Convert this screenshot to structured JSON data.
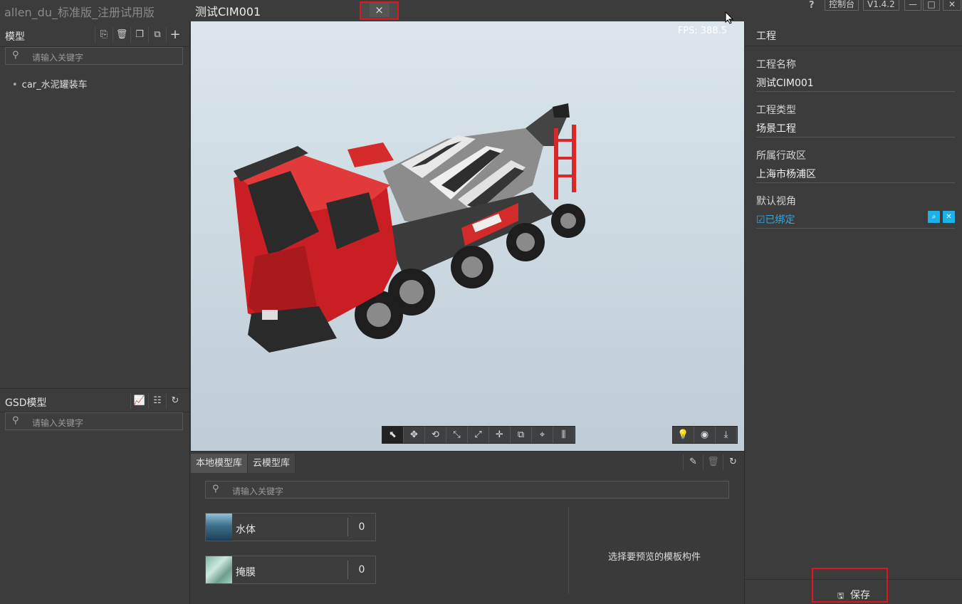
{
  "titlebar": {
    "app_title": "allen_du_标准版_注册试用版",
    "tab_title": "测试CIM001",
    "tab_close": "×",
    "help": "?",
    "console": "控制台",
    "version": "V1.4.2",
    "minimize": "—",
    "maximize": "□",
    "close": "✕"
  },
  "models_panel": {
    "title": "模型",
    "icons": [
      "export-icon",
      "trash-icon",
      "copy-icon",
      "paste-icon",
      "plus-icon"
    ],
    "search_placeholder": "请输入关键字",
    "items": [
      {
        "label": "car_水泥罐装车"
      }
    ]
  },
  "gsd_panel": {
    "title": "GSD模型",
    "icons": [
      "chart-icon",
      "layers-icon",
      "refresh-icon"
    ],
    "search_placeholder": "请输入关键字"
  },
  "viewport": {
    "fps": "FPS: 388.5",
    "tools": [
      "select-icon",
      "pan-icon",
      "orbit-icon",
      "shrink-icon",
      "expand-icon",
      "move-icon",
      "copy-tool-icon",
      "center-icon",
      "split-icon"
    ],
    "tools2": [
      "light-icon",
      "eye-icon",
      "download-icon"
    ]
  },
  "library": {
    "tabs": [
      {
        "label": "本地模型库"
      },
      {
        "label": "云模型库"
      }
    ],
    "search_placeholder": "请输入关键字",
    "cards": [
      {
        "name": "水体",
        "count": "0"
      },
      {
        "name": "掩膜",
        "count": "0"
      }
    ],
    "preview_hint": "选择要预览的模板构件"
  },
  "project_panel": {
    "title": "工程",
    "props": [
      {
        "key": "工程名称",
        "value": "测试CIM001"
      },
      {
        "key": "工程类型",
        "value": "场景工程"
      },
      {
        "key": "所属行政区",
        "value": "上海市杨浦区"
      },
      {
        "key": "默认视角",
        "value": "☑已绑定"
      }
    ],
    "save_label": "保存"
  },
  "colors": {
    "accent_red": "#e0161e",
    "link_blue": "#2fa9e0",
    "panel_bg": "#3c3c3c"
  }
}
